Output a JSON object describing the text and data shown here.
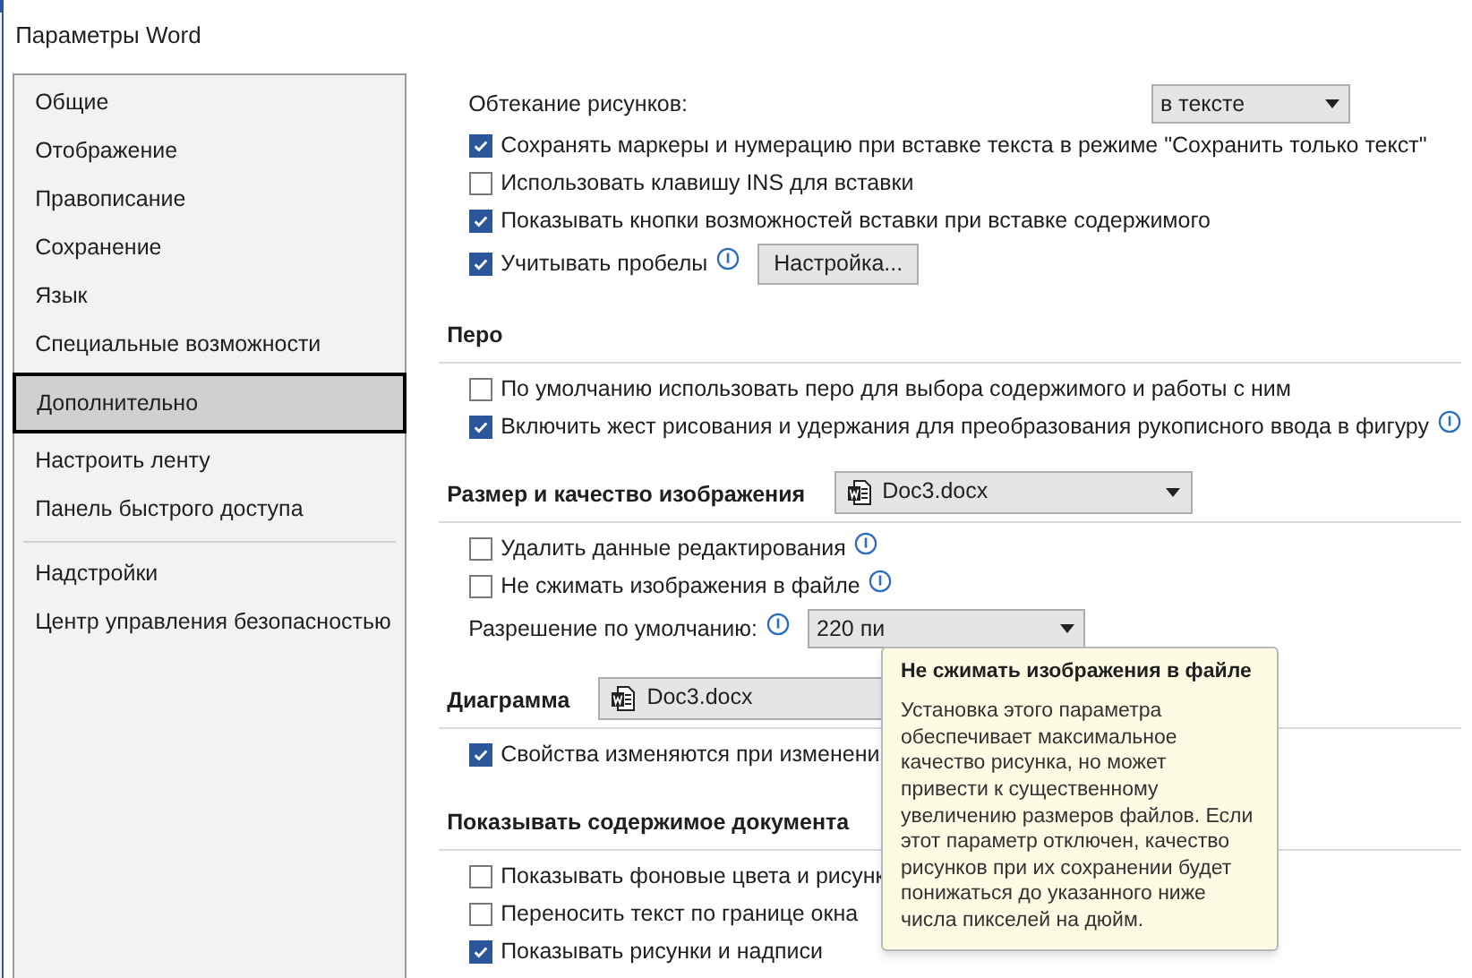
{
  "window": {
    "title": "Параметры Word"
  },
  "sidebar": {
    "groups": [
      [
        {
          "label": "Общие",
          "selected": false
        },
        {
          "label": "Отображение",
          "selected": false
        },
        {
          "label": "Правописание",
          "selected": false
        },
        {
          "label": "Сохранение",
          "selected": false
        },
        {
          "label": "Язык",
          "selected": false
        },
        {
          "label": "Специальные возможности",
          "selected": false
        },
        {
          "label": "Дополнительно",
          "selected": true
        },
        {
          "label": "Настроить ленту",
          "selected": false
        },
        {
          "label": "Панель быстрого доступа",
          "selected": false
        }
      ],
      [
        {
          "label": "Надстройки",
          "selected": false
        },
        {
          "label": "Центр управления безопасностью",
          "selected": false
        }
      ]
    ]
  },
  "content": {
    "rows": [
      {
        "kind": "select",
        "label": "Обтекание рисунков:",
        "value": "в тексте",
        "info": false
      },
      {
        "kind": "checkbox",
        "label": "Сохранять маркеры и нумерацию при вставке текста в режиме \"Сохранить только текст\"",
        "checked": true,
        "info": false
      },
      {
        "kind": "checkbox",
        "label": "Использовать клавишу INS для вставки",
        "checked": false,
        "info": false
      },
      {
        "kind": "checkbox",
        "label": "Показывать кнопки возможностей вставки при вставке содержимого",
        "checked": true,
        "info": false
      },
      {
        "kind": "checkbox",
        "label": "Учитывать пробелы",
        "checked": true,
        "info": true,
        "button": "Настройка..."
      },
      {
        "kind": "header",
        "label": "Перо"
      },
      {
        "kind": "checkbox",
        "label": "По умолчанию использовать перо для выбора содержимого и работы с ним",
        "checked": false,
        "info": false
      },
      {
        "kind": "checkbox",
        "label": "Включить жест рисования и удержания для преобразования рукописного ввода в фигуру",
        "checked": true,
        "info": true
      },
      {
        "kind": "header",
        "label": "Размер и качество изображения",
        "document": "Doc3.docx"
      },
      {
        "kind": "checkbox",
        "label": "Удалить данные редактирования",
        "checked": false,
        "info": true
      },
      {
        "kind": "checkbox",
        "label": "Не сжимать изображения в файле",
        "checked": false,
        "info": true
      },
      {
        "kind": "select",
        "label": "Разрешение по умолчанию:",
        "value": "220 пи",
        "info": true
      },
      {
        "kind": "header",
        "label": "Диаграмма",
        "document": "Doc3.docx"
      },
      {
        "kind": "checkbox",
        "label": "Свойства изменяются при изменени",
        "checked": true,
        "info": false
      },
      {
        "kind": "header",
        "label": "Показывать содержимое документа"
      },
      {
        "kind": "checkbox",
        "label": "Показывать фоновые цвета и рисунк",
        "checked": false,
        "info": false
      },
      {
        "kind": "checkbox",
        "label": "Переносить текст по границе окна",
        "checked": false,
        "info": false
      },
      {
        "kind": "checkbox",
        "label": "Показывать рисунки и надписи",
        "checked": true,
        "info": false
      }
    ]
  },
  "tooltip": {
    "title": "Не сжимать изображения в файле",
    "text": "Установка этого параметра обеспечивает максимальное качество рисунка, но может привести к существенному увеличению размеров файлов. Если этот параметр отключен, качество рисунков при их сохранении будет понижаться до указанного ниже числа пикселей на дюйм."
  }
}
